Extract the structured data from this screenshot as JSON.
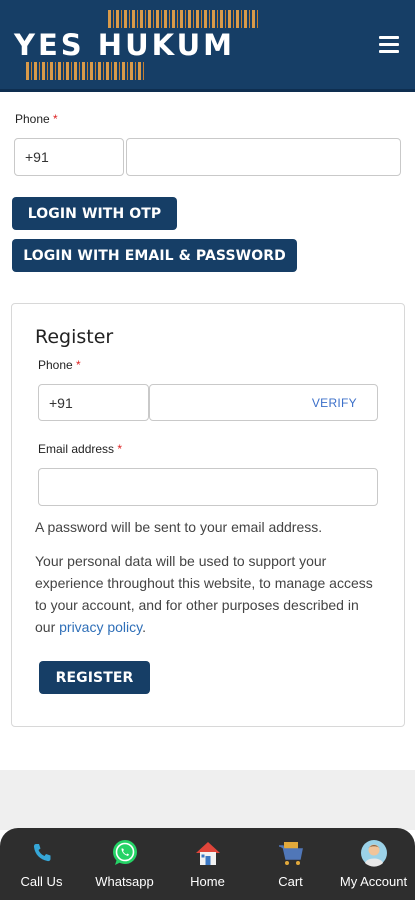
{
  "header": {
    "logo_text": "YES HUKUM",
    "menu_icon": "hamburger-menu-icon"
  },
  "login": {
    "phone_label": "Phone",
    "required_mark": "*",
    "country_code": "+91",
    "phone_value": "",
    "otp_button": "LOGIN WITH OTP",
    "email_password_button": "LOGIN WITH EMAIL & PASSWORD"
  },
  "register": {
    "title": "Register",
    "phone_label": "Phone",
    "required_mark": "*",
    "country_code": "+91",
    "phone_value": "",
    "verify_label": "VERIFY",
    "email_label": "Email address",
    "email_value": "",
    "password_note": "A password will be sent to your email address.",
    "privacy_text": "Your personal data will be used to support your experience throughout this website, to manage access to your account, and for other purposes described in our",
    "privacy_link": "privacy policy",
    "privacy_end": ".",
    "register_button": "REGISTER"
  },
  "bottom_nav": {
    "items": [
      {
        "label": "Call Us",
        "icon": "phone-icon"
      },
      {
        "label": "Whatsapp",
        "icon": "whatsapp-icon"
      },
      {
        "label": "Home",
        "icon": "home-icon"
      },
      {
        "label": "Cart",
        "icon": "cart-icon"
      },
      {
        "label": "My Account",
        "icon": "account-avatar-icon"
      }
    ]
  },
  "colors": {
    "brand": "#163e66",
    "accent_gold": "#d89a4a",
    "link": "#2f6fb8",
    "required": "#dd2222",
    "nav_bg": "#2e2e2e"
  }
}
